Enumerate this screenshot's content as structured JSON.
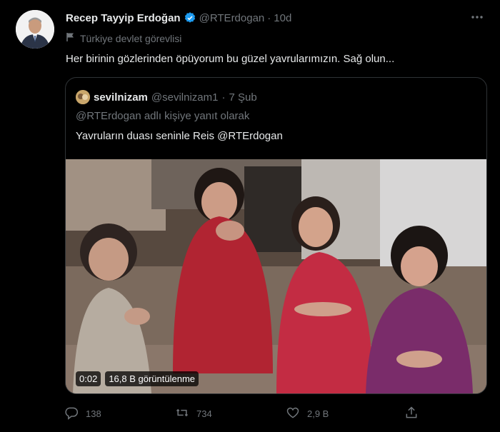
{
  "author": {
    "name": "Recep Tayyip Erdoğan",
    "handle": "@RTErdogan",
    "separator": "·",
    "time": "10d",
    "label": "Türkiye devlet görevlisi"
  },
  "tweet_text": "Her birinin gözlerinden öpüyorum bu güzel yavrularımızın. Sağ olun...",
  "quoted": {
    "name": "sevilnizam",
    "handle": "@sevilnizam1",
    "separator": "·",
    "time": "7 Şub",
    "reply_to": "@RTErdogan adlı kişiye yanıt olarak",
    "text": "Yavruların duası seninle Reis @RTErdogan",
    "video": {
      "duration": "0:02",
      "views": "16,8 B görüntülenme"
    }
  },
  "actions": {
    "replies": "138",
    "retweets": "734",
    "likes": "2,9 B"
  },
  "icons": [
    "verified-icon",
    "more-icon",
    "label-flag-icon",
    "reply-icon",
    "retweet-icon",
    "like-icon",
    "share-icon"
  ],
  "colors": {
    "background": "#000000",
    "text": "#e7e9ea",
    "muted": "#71767b",
    "border": "#2f3336",
    "verified": "#1d9bf0"
  }
}
